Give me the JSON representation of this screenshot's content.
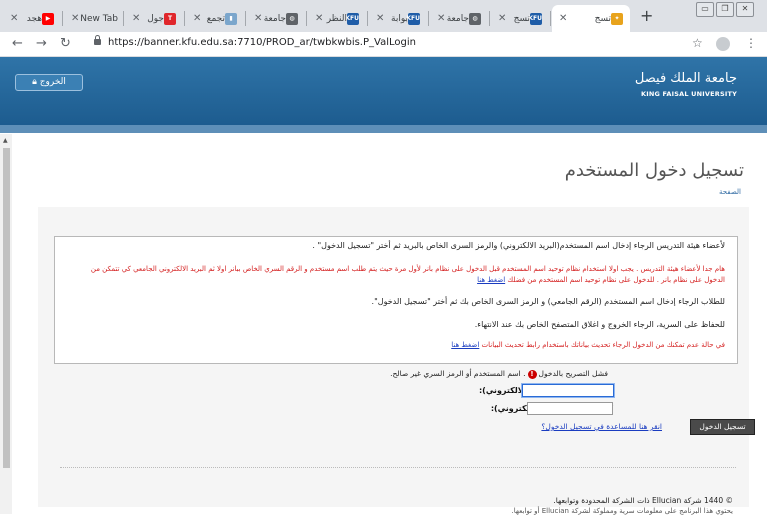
{
  "browser": {
    "tabs": [
      {
        "label": "هجد",
        "icon": "youtube-icon",
        "color": "#ff0000",
        "active": false
      },
      {
        "label": "New Tab",
        "icon": "",
        "color": "",
        "active": false
      },
      {
        "label": "جول",
        "icon": "t-icon",
        "color": "#e0262b",
        "active": false
      },
      {
        "label": "تجمع",
        "icon": "bookmark-icon",
        "color": "#7ba6cc",
        "active": false
      },
      {
        "label": "جامعة",
        "icon": "globe-icon",
        "color": "#5f6368",
        "active": false
      },
      {
        "label": "النظر",
        "icon": "kfu-icon",
        "color": "#1f5da8",
        "active": false
      },
      {
        "label": "بوابة",
        "icon": "kfu-icon",
        "color": "#1f5da8",
        "active": false
      },
      {
        "label": "جامعة",
        "icon": "globe-icon",
        "color": "#5f6368",
        "active": false
      },
      {
        "label": "تسج",
        "icon": "kfu-icon",
        "color": "#1f5da8",
        "active": false
      },
      {
        "label": "تسج",
        "icon": "kfu-logo-icon",
        "color": "#e8a31c",
        "active": true
      }
    ],
    "url": "https://banner.kfu.edu.sa:7710/PROD_ar/twbkwbis.P_ValLogin",
    "window_controls": [
      "minimize",
      "restore",
      "close"
    ]
  },
  "header": {
    "logout_label": "الخروج",
    "university_ar": "جامعة الملك فيصل",
    "university_en": "KING FAISAL UNIVERSITY"
  },
  "page": {
    "title": "تسجيل دخول المستخدم",
    "breadcrumb": "الصفحة"
  },
  "info": {
    "faculty_line": "لأعضاء هيئة التدريس الرجاء إدخال اسم المستخدم(البريد الالكتروني) والرمز السرى الخاص بالبريد ثم أختر \"تسجيل الدخول\" .",
    "faculty_note": "هام جدا لأعضاء هيئة التدريس . يجب اولا استخدام نظام توحيد اسم المستخدم قبل الدخول على نظام بانر لأول مرة حيث يتم طلب اسم مستخدم و الرقم السري الخاص ببانر اولا ثم البريد الالكتروني الجامعي كي تتمكن من",
    "faculty_note2_pre": "الدخول على نظام بانر . للدخول على نظام توحيد اسم المستخدم من فضلك",
    "faculty_note2_link": "اضغط هنا",
    "student_line": "للطلاب الرجاء إدخال اسم المستخدم (الرقم الجامعي) و الرمز السرى الخاص بك ثم أختر \"تسجيل الدخول\".",
    "security_line": "للحفاظ على السرية، الرجاء الخروج و اغلاق المتصفح الخاص بك عند الانتهاء.",
    "update_pre": "في حالة عدم تمكنك من الدخول الرجاء تحديث بياناتك باستخدام رابط تحديث البيانات",
    "update_link": "اضغط هنا"
  },
  "form": {
    "error_title": "فشل التصريح بالدخول",
    "error_detail": ". اسم المستخدم أو الرمز السري غير صالح.",
    "username_label": "اسم المستخدم(البريد الالكتروني):",
    "username_value": "",
    "password_label": "كلمة المرور(البريد الالكتروني):",
    "password_value": "",
    "login_button": "تسجيل الدخول",
    "help_link": "انقر هنا للمساعدة في تسجيل الدخول؟"
  },
  "footer": {
    "copyright": "© 1440 شركة Ellucian ذات الشركة المحدودة وتوابعها.",
    "copyright2": "يحتوي هذا البرنامج على معلومات سرية ومملوكة لشركة Ellucian أو توابعها."
  }
}
